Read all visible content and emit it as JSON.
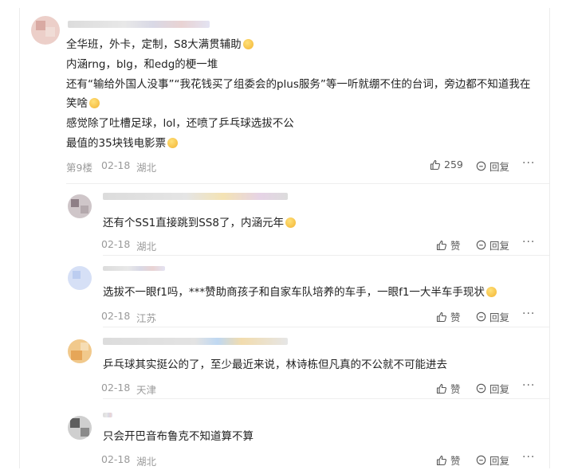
{
  "main": {
    "lines": [
      "全华班，外卡，定制，S8大满贯辅助",
      "内涵rng，blg，和edg的梗一堆",
      "还有“输给外国人没事”“我花钱买了组委会的plus服务”等一听就绷不住的台词，旁边都不知道我在",
      "笑啥",
      "感觉除了吐槽足球，lol，还喷了乒乓球选拔不公",
      "最值的35块钱电影票"
    ],
    "floor": "第9楼",
    "date": "02-18",
    "location": "湖北",
    "likes": "259",
    "reply_label": "回复",
    "more_label": "···"
  },
  "replies": [
    {
      "text": "还有个SS1直接跳到SS8了，内涵元年",
      "date": "02-18",
      "location": "湖北",
      "like_label": "赞",
      "reply_label": "回复",
      "more_label": "···"
    },
    {
      "text": "选拔不一眼f1吗，***赞助商孩子和自家车队培养的车手，一眼f1一大半车手现状",
      "date": "02-18",
      "location": "江苏",
      "like_label": "赞",
      "reply_label": "回复",
      "more_label": "···"
    },
    {
      "text": "乒乓球其实挺公的了，至少最近来说，林诗栋但凡真的不公就不可能进去",
      "date": "02-18",
      "location": "天津",
      "like_label": "赞",
      "reply_label": "回复",
      "more_label": "···"
    },
    {
      "text": "只会开巴音布鲁克不知道算不算",
      "date": "02-18",
      "location": "湖北",
      "like_label": "赞",
      "reply_label": "回复",
      "more_label": "···"
    }
  ],
  "icons": {
    "like": "thumbs-up-icon",
    "reply": "comment-bubble-icon",
    "more": "more-dots-icon",
    "emoji": "emoji-face-icon"
  }
}
